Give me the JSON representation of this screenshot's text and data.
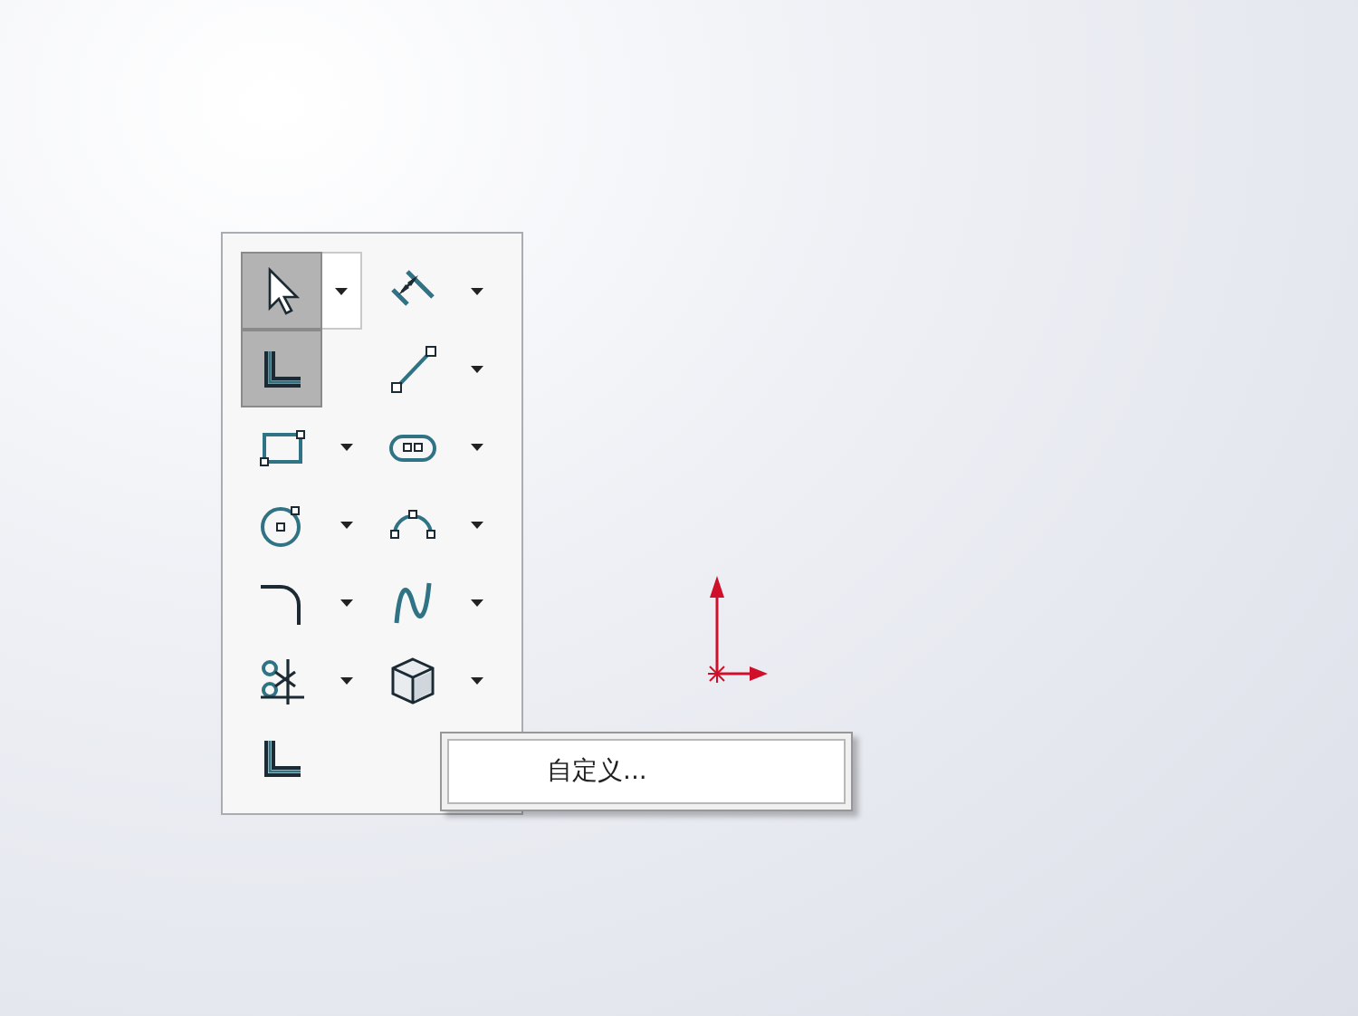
{
  "toolbar": {
    "tools": [
      {
        "kind": "select",
        "selected": true,
        "dropdown": true
      },
      {
        "kind": "dimension",
        "selected": false,
        "dropdown": true
      },
      {
        "kind": "sketch",
        "selected": true,
        "dropdown": false
      },
      {
        "kind": "line",
        "selected": false,
        "dropdown": true
      },
      {
        "kind": "rectangle",
        "selected": false,
        "dropdown": true
      },
      {
        "kind": "slot",
        "selected": false,
        "dropdown": true
      },
      {
        "kind": "circle",
        "selected": false,
        "dropdown": true
      },
      {
        "kind": "arc",
        "selected": false,
        "dropdown": true
      },
      {
        "kind": "fillet",
        "selected": false,
        "dropdown": true
      },
      {
        "kind": "spline",
        "selected": false,
        "dropdown": true
      },
      {
        "kind": "trim",
        "selected": false,
        "dropdown": true
      },
      {
        "kind": "cube",
        "selected": false,
        "dropdown": true
      },
      {
        "kind": "sketch",
        "selected": false,
        "dropdown": false
      }
    ]
  },
  "context_menu": {
    "items": [
      {
        "label": "自定义..."
      }
    ]
  }
}
